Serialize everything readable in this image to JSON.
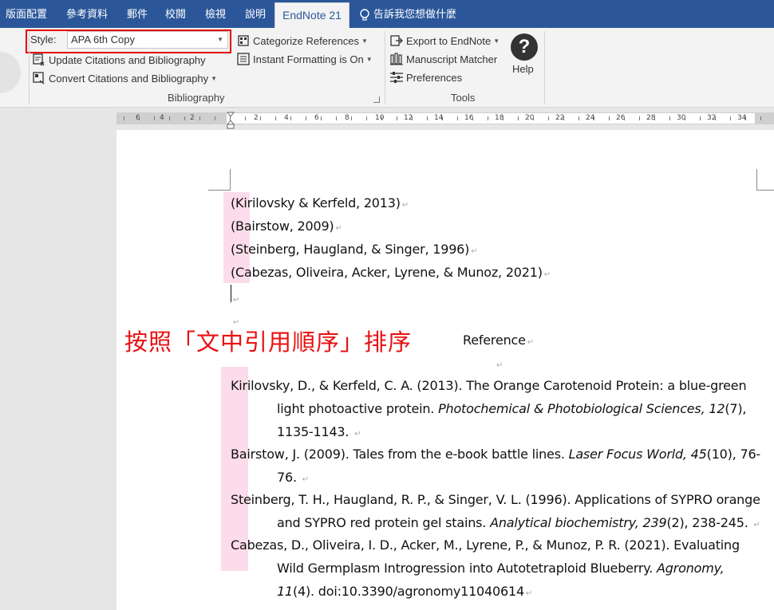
{
  "tabs": [
    {
      "label": "版面配置",
      "active": false
    },
    {
      "label": "參考資料",
      "active": false
    },
    {
      "label": "郵件",
      "active": false
    },
    {
      "label": "校閱",
      "active": false
    },
    {
      "label": "檢視",
      "active": false
    },
    {
      "label": "說明",
      "active": false
    },
    {
      "label": "EndNote 21",
      "active": true
    }
  ],
  "tell_me": "告訴我您想做什麼",
  "ribbon": {
    "style_label": "Style:",
    "style_value": "APA 6th Copy",
    "update_citations": "Update Citations and Bibliography",
    "convert_citations": "Convert Citations and Bibliography",
    "categorize_references": "Categorize References",
    "instant_formatting": "Instant Formatting is On",
    "export_to_endnote": "Export to EndNote",
    "manuscript_matcher": "Manuscript Matcher",
    "preferences": "Preferences",
    "help": "Help",
    "help_symbol": "?",
    "group_bibliography": "Bibliography",
    "group_tools": "Tools"
  },
  "ruler_ticks": [
    "6",
    "4",
    "2",
    "2",
    "4",
    "6",
    "8",
    "10",
    "12",
    "14",
    "16",
    "18",
    "20",
    "22",
    "24",
    "26",
    "28",
    "30",
    "32",
    "34"
  ],
  "document": {
    "citations": [
      "(Kirilovsky & Kerfeld, 2013)",
      "(Bairstow, 2009)",
      "(Steinberg, Haugland, & Singer, 1996)",
      "(Cabezas, Oliveira, Acker, Lyrene, & Munoz, 2021)"
    ],
    "annotation": "按照「文中引用順序」排序",
    "reference_heading": "Reference",
    "references": [
      {
        "l1": "Kirilovsky, D., & Kerfeld, C. A. (2013). The Orange Carotenoid Protein: a blue-green",
        "l2a": "light photoactive protein. ",
        "l2i": "Photochemical & Photobiological Sciences, 12",
        "l2b": "(7),",
        "l3": "1135-1143. "
      },
      {
        "l1a": "Bairstow, J. (2009). Tales from the e-book battle lines. ",
        "l1i": "Laser Focus World, 45",
        "l1b": "(10), 76-",
        "l2": "76. "
      },
      {
        "l1": "Steinberg, T. H., Haugland, R. P., & Singer, V. L. (1996). Applications of SYPRO orange",
        "l2a": "and SYPRO red protein gel stains. ",
        "l2i": "Analytical biochemistry, 239",
        "l2b": "(2), 238-245. "
      },
      {
        "l1": "Cabezas, D., Oliveira, I. D., Acker, M., Lyrene, P., & Munoz, P. R. (2021). Evaluating",
        "l2a": "Wild Germplasm Introgression into Autotetraploid Blueberry. ",
        "l2i": "Agronomy,",
        "l3i": "11",
        "l3b": "(4). doi:10.3390/agronomy11040614"
      }
    ]
  },
  "colors": {
    "tab_bar": "#2b579a",
    "ribbon": "#f3f3f3",
    "highlight": "#fcdcea",
    "annotation": "#e81010",
    "style_box_outline": "#e30000"
  }
}
